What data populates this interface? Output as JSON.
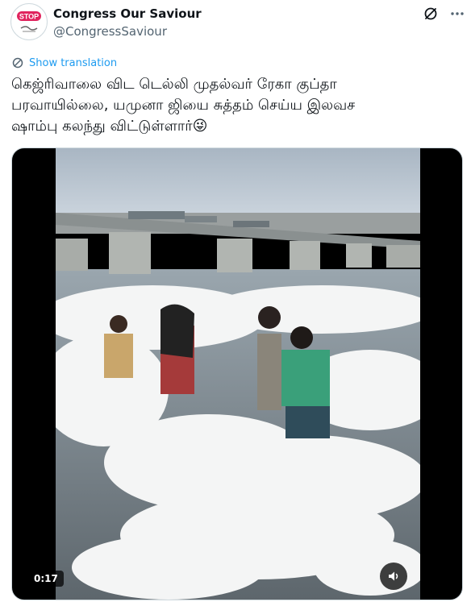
{
  "author": {
    "display_name": "Congress Our Saviour",
    "handle": "@CongressSaviour",
    "avatar_text": "STOP"
  },
  "tweet": {
    "translate_label": "Show translation",
    "text": "கெஜ்ரிவாலை விட டெல்லி முதல்வர் ரேகா குப்தா\nபரவாயில்லை, யமுனா ஜியை சுத்தம் செய்ய இலவச\nஷாம்பு கலந்து விட்டுள்ளார்😜"
  },
  "media": {
    "duration": "0:17",
    "description_icon": "volume-icon"
  },
  "icons": {
    "grok": "grok-icon",
    "more": "more-icon",
    "translate": "translate-icon"
  },
  "colors": {
    "accent": "#1d9bf0",
    "secondary_text": "#536471",
    "text": "#0f1419"
  }
}
